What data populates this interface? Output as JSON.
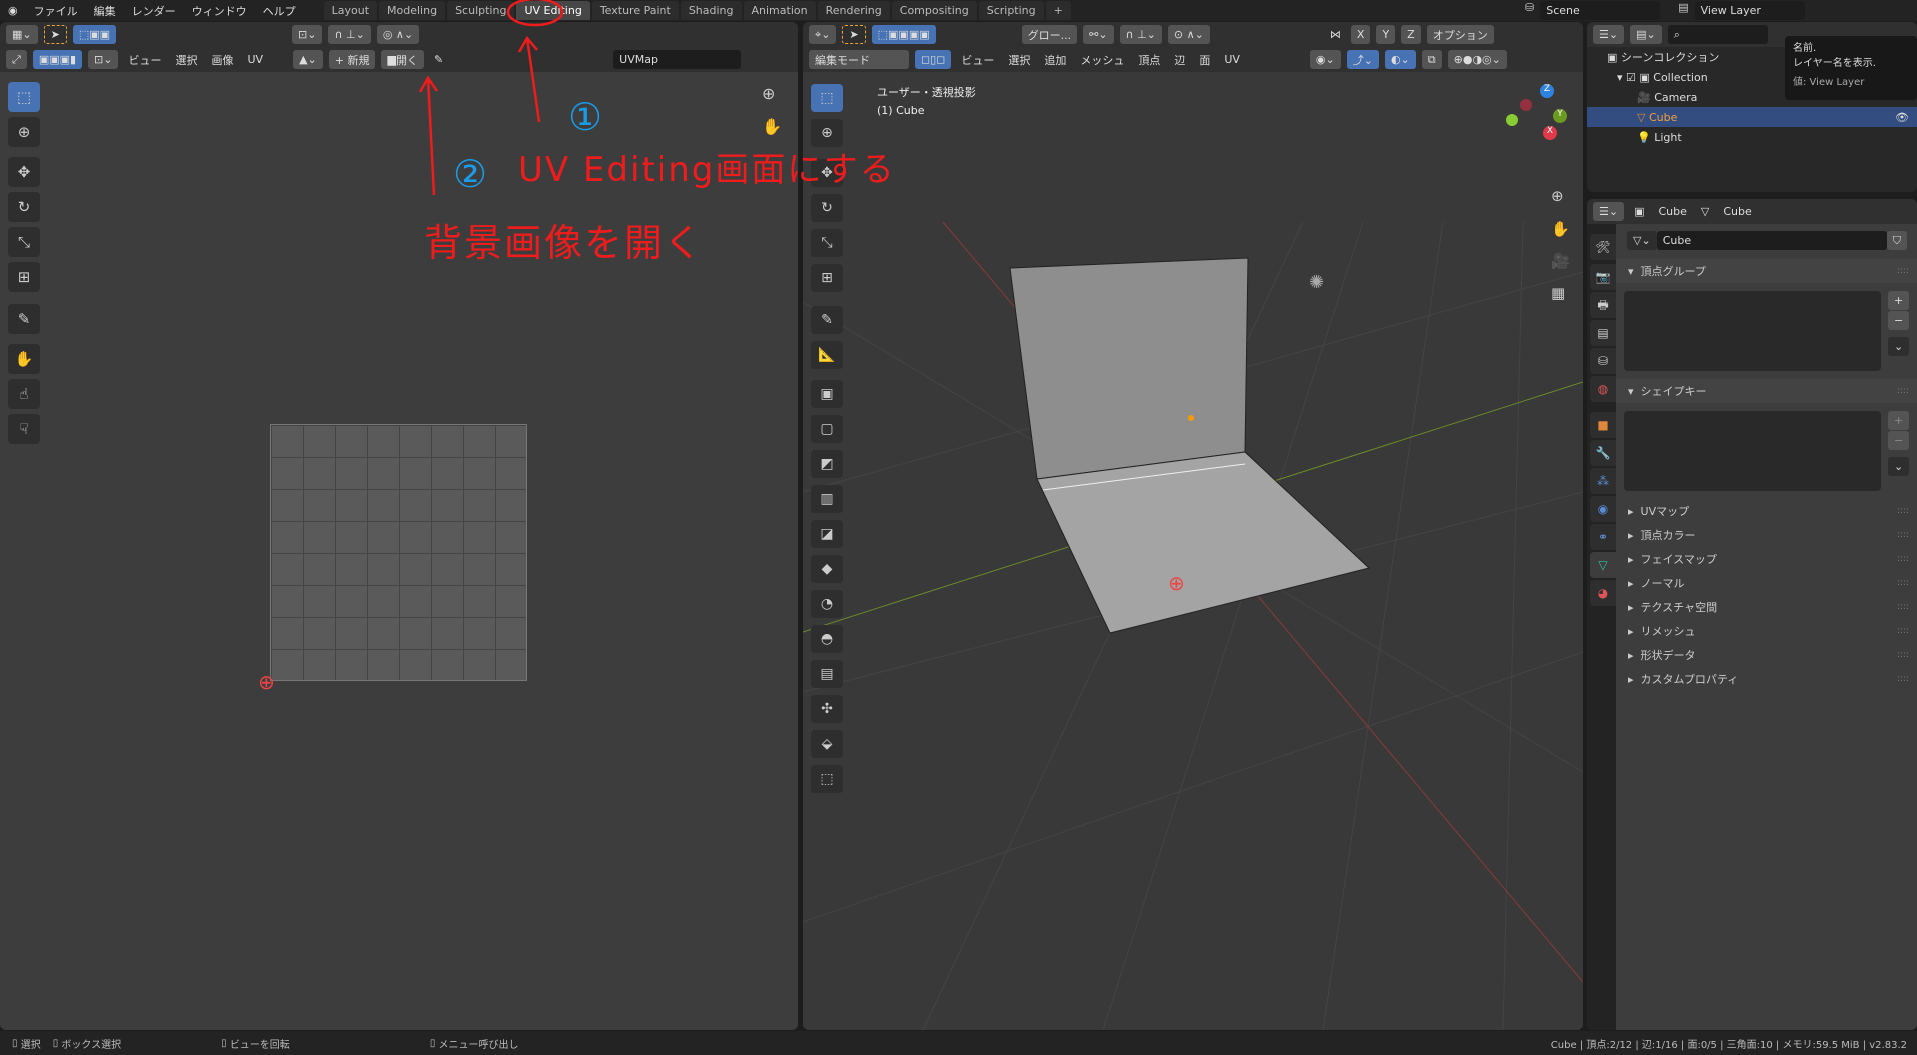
{
  "topbar": {
    "menus": [
      "ファイル",
      "編集",
      "レンダー",
      "ウィンドウ",
      "ヘルプ"
    ],
    "tabs": [
      "Layout",
      "Modeling",
      "Sculpting",
      "UV Editing",
      "Texture Paint",
      "Shading",
      "Animation",
      "Rendering",
      "Compositing",
      "Scripting",
      "+"
    ],
    "active_tab": "UV Editing",
    "scene": "Scene",
    "view_layer": "View Layer"
  },
  "uv_editor": {
    "menus": [
      "ビュー",
      "選択",
      "画像",
      "UV"
    ],
    "new_label": "+ 新規",
    "open_label": "開く",
    "uvmap": "UVMap"
  },
  "viewport": {
    "mode": "編集モード",
    "menus": [
      "ビュー",
      "選択",
      "追加",
      "メッシュ",
      "頂点",
      "辺",
      "面",
      "UV"
    ],
    "orientation": "グロー...",
    "options": "オプション",
    "axes": [
      "X",
      "Y",
      "Z"
    ],
    "view_name": "ユーザー・透視投影",
    "object_name": "(1) Cube",
    "gizmo": [
      "Z",
      "Y",
      "X"
    ]
  },
  "outliner": {
    "scene_collection": "シーンコレクション",
    "items": [
      {
        "name": "Collection"
      },
      {
        "name": "Camera"
      },
      {
        "name": "Cube",
        "selected": true
      },
      {
        "name": "Light"
      }
    ],
    "tooltip": {
      "line1": "名前.",
      "line2": "レイヤー名を表示.",
      "line3": "値: View Layer"
    }
  },
  "properties": {
    "breadcrumb_object": "Cube",
    "breadcrumb_data": "Cube",
    "mesh_name": "Cube",
    "panels": [
      "頂点グループ",
      "シェイプキー",
      "UVマップ",
      "頂点カラー",
      "フェイスマップ",
      "ノーマル",
      "テクスチャ空間",
      "リメッシュ",
      "形状データ",
      "カスタムプロパティ"
    ]
  },
  "statusbar": {
    "select": "選択",
    "box_select": "ボックス選択",
    "rotate_view": "ビューを回転",
    "call_menu": "メニュー呼び出し",
    "stats": "Cube | 頂点:2/12 | 辺:1/16 | 面:0/5 | 三角面:10 | メモリ:59.5 MiB | v2.83.2"
  },
  "annotations": {
    "num1": "①",
    "text1": "UV Editing画面にする",
    "num2": "②",
    "text2": "背景画像を開く",
    "color": "#ee1c1c",
    "num_color": "#1a9be8"
  }
}
